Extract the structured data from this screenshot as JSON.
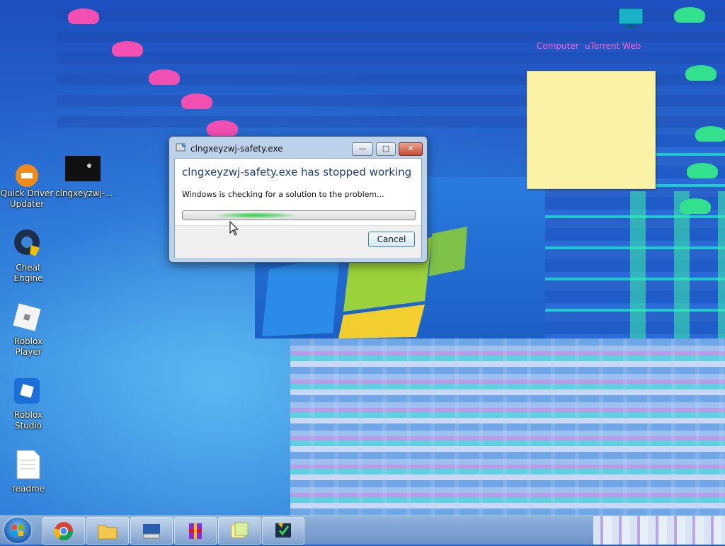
{
  "desktop": {
    "icons": [
      {
        "label": "Quick Driver Updater",
        "icon": "quick-driver-updater-icon"
      },
      {
        "label": "clngxeyzwj-...",
        "icon": "exe-thumbnail-icon"
      },
      {
        "label": "Cheat Engine",
        "icon": "cheat-engine-icon"
      },
      {
        "label": "Roblox Player",
        "icon": "roblox-player-icon"
      },
      {
        "label": "Roblox Studio",
        "icon": "roblox-studio-icon"
      },
      {
        "label": "readme",
        "icon": "text-file-icon"
      }
    ],
    "top_right_icons": [
      {
        "label": "Computer",
        "icon": "computer-icon"
      },
      {
        "label": "uTorrent Web",
        "icon": "utorrent-icon"
      }
    ]
  },
  "dialog": {
    "title": "clngxeyzwj-safety.exe",
    "headline": "clngxeyzwj-safety.exe has stopped working",
    "message": "Windows is checking for a solution to the problem...",
    "cancel_label": "Cancel",
    "minimize_label": "—",
    "maximize_label": "□",
    "close_label": "✕"
  },
  "taskbar": {
    "items": [
      {
        "icon": "start-orb-icon"
      },
      {
        "icon": "chrome-icon"
      },
      {
        "icon": "file-explorer-icon"
      },
      {
        "icon": "on-screen-keyboard-icon"
      },
      {
        "icon": "winrar-icon"
      },
      {
        "icon": "sticky-notes-icon"
      },
      {
        "icon": "cheat-engine-task-icon"
      }
    ]
  },
  "colors": {
    "accent": "#1c3a78",
    "progress": "#2fd44b",
    "sticky": "#fbf2a6"
  }
}
